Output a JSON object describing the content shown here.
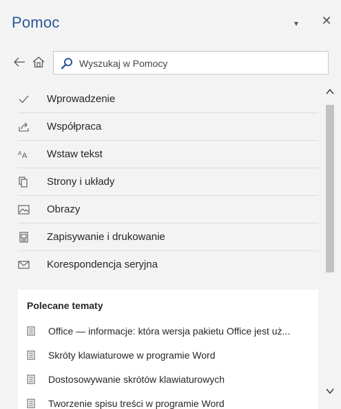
{
  "pane": {
    "title": "Pomoc",
    "dropdown_glyph": "▾",
    "close_glyph": "✕"
  },
  "nav": {
    "back_icon": "arrow-left-icon",
    "home_icon": "home-icon"
  },
  "search": {
    "placeholder": "Wyszukaj w Pomocy",
    "value": "",
    "icon": "search-icon"
  },
  "categories": [
    {
      "label": "Wprowadzenie",
      "icon": "checkmark-icon"
    },
    {
      "label": "Współpraca",
      "icon": "share-icon"
    },
    {
      "label": "Wstaw tekst",
      "icon": "font-size-icon"
    },
    {
      "label": "Strony i układy",
      "icon": "pages-icon"
    },
    {
      "label": "Obrazy",
      "icon": "picture-icon"
    },
    {
      "label": "Zapisywanie i drukowanie",
      "icon": "printer-icon"
    },
    {
      "label": "Korespondencja seryjna",
      "icon": "envelope-icon"
    }
  ],
  "recommended": {
    "title": "Polecane tematy",
    "items": [
      {
        "label": "Office — informacje: która wersja pakietu Office jest uż..."
      },
      {
        "label": "Skróty klawiaturowe w programie Word"
      },
      {
        "label": "Dostosowywanie skrótów klawiaturowych"
      },
      {
        "label": "Tworzenie spisu treści w programie Word"
      }
    ]
  },
  "scrollbar": {
    "up_icon": "chevron-up-icon",
    "down_icon": "chevron-down-icon",
    "position_fraction": 0.0
  },
  "colors": {
    "title": "#2b579a",
    "background": "#f3f3f3",
    "panel": "#ffffff",
    "thumb": "#c2c2c2"
  }
}
